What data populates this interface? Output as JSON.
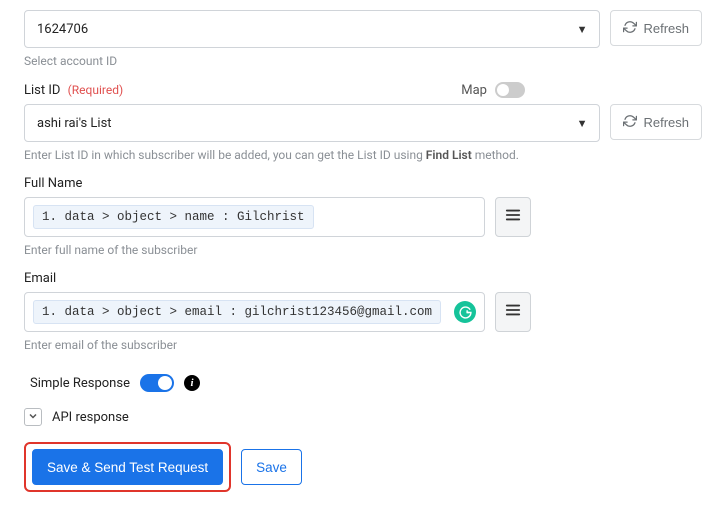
{
  "accountId": {
    "value": "1624706",
    "helper": "Select account ID",
    "refresh": "Refresh"
  },
  "listId": {
    "label": "List ID",
    "required": "(Required)",
    "mapLabel": "Map",
    "value": "ashi rai's List",
    "refresh": "Refresh",
    "helperPre": "Enter List ID in which subscriber will be added, you can get the List ID using ",
    "helperBold": "Find List",
    "helperSuf": " method."
  },
  "fullName": {
    "label": "Full Name",
    "chip": "1. data > object > name : Gilchrist",
    "helper": "Enter full name of the subscriber"
  },
  "email": {
    "label": "Email",
    "chip": "1. data > object > email : gilchrist123456@gmail.com",
    "helper": "Enter email of the subscriber",
    "badge": "G"
  },
  "simpleResponse": {
    "label": "Simple Response"
  },
  "apiResponse": {
    "label": "API response"
  },
  "actions": {
    "primary": "Save & Send Test Request",
    "secondary": "Save"
  }
}
